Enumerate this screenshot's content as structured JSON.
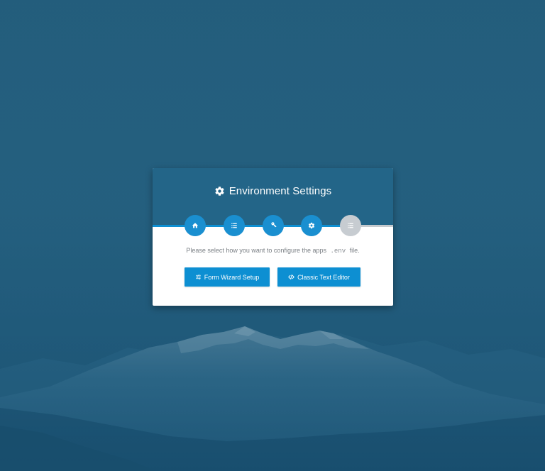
{
  "window": {
    "title": "Environment Settings"
  },
  "steps": [
    {
      "icon": "home-icon",
      "state": "complete"
    },
    {
      "icon": "list-icon",
      "state": "complete"
    },
    {
      "icon": "key-icon",
      "state": "complete"
    },
    {
      "icon": "gear-icon",
      "state": "complete"
    },
    {
      "icon": "list-icon",
      "state": "inactive"
    }
  ],
  "progress": {
    "completed_fraction": 0.8
  },
  "prompt": {
    "before": "Please select how you want to configure the apps",
    "code": ".env",
    "after": "file."
  },
  "buttons": {
    "wizard_label": "Form Wizard Setup",
    "editor_label": "Classic Text Editor"
  },
  "colors": {
    "background": "#235d7c",
    "header": "#236588",
    "accent": "#0d8fd2",
    "step_inactive": "#c7ccd1"
  }
}
